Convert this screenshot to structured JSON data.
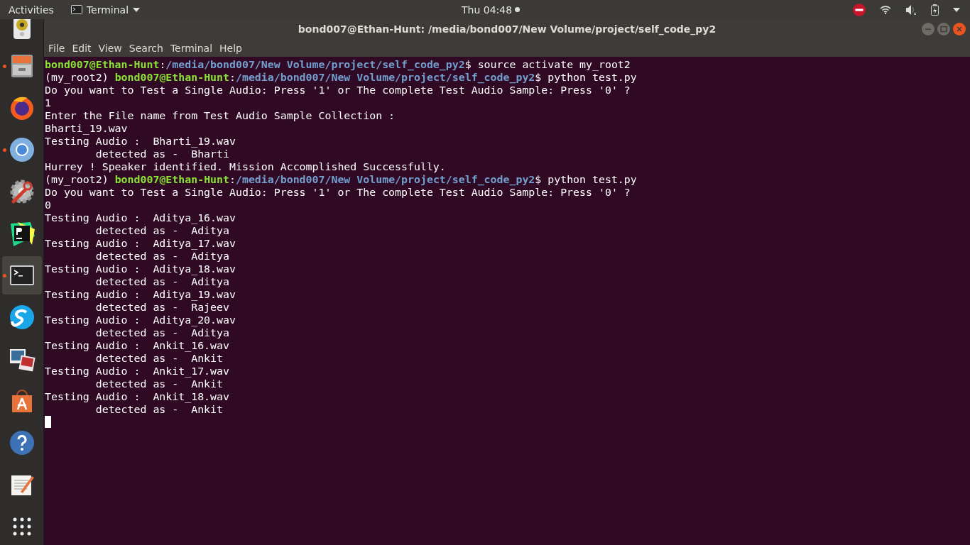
{
  "top_bar": {
    "activities": "Activities",
    "app_menu": "Terminal",
    "clock": "Thu 04:48"
  },
  "dock": [
    {
      "running": false,
      "selected": false
    },
    {
      "running": true,
      "selected": false
    },
    {
      "running": false,
      "selected": false
    },
    {
      "running": true,
      "selected": false
    },
    {
      "running": false,
      "selected": false
    },
    {
      "running": false,
      "selected": false
    },
    {
      "running": true,
      "selected": true
    },
    {
      "running": false,
      "selected": false
    },
    {
      "running": false,
      "selected": false
    },
    {
      "running": false,
      "selected": false
    },
    {
      "running": false,
      "selected": false
    },
    {
      "running": false,
      "selected": false
    },
    {
      "running": false,
      "selected": false
    }
  ],
  "window": {
    "title": "bond007@Ethan-Hunt: /media/bond007/New Volume/project/self_code_py2"
  },
  "menu": [
    "File",
    "Edit",
    "View",
    "Search",
    "Terminal",
    "Help"
  ],
  "terminal": {
    "lines": [
      [
        {
          "kind": "user",
          "text": "bond007@Ethan-Hunt"
        },
        {
          "kind": "plain",
          "text": ":"
        },
        {
          "kind": "path",
          "text": "/media/bond007/New Volume/project/self_code_py2"
        },
        {
          "kind": "plain",
          "text": "$ source activate my_root2"
        }
      ],
      [
        {
          "kind": "plain",
          "text": "(my_root2) "
        },
        {
          "kind": "user",
          "text": "bond007@Ethan-Hunt"
        },
        {
          "kind": "plain",
          "text": ":"
        },
        {
          "kind": "path",
          "text": "/media/bond007/New Volume/project/self_code_py2"
        },
        {
          "kind": "plain",
          "text": "$ python test.py"
        }
      ],
      [
        {
          "kind": "plain",
          "text": "Do you want to Test a Single Audio: Press '1' or The complete Test Audio Sample: Press '0' ?"
        }
      ],
      [
        {
          "kind": "plain",
          "text": "1"
        }
      ],
      [
        {
          "kind": "plain",
          "text": "Enter the File name from Test Audio Sample Collection :"
        }
      ],
      [
        {
          "kind": "plain",
          "text": "Bharti_19.wav"
        }
      ],
      [
        {
          "kind": "plain",
          "text": "Testing Audio :  Bharti_19.wav"
        }
      ],
      [
        {
          "kind": "plain",
          "text": "        detected as -  Bharti"
        }
      ],
      [
        {
          "kind": "plain",
          "text": "Hurrey ! Speaker identified. Mission Accomplished Successfully."
        }
      ],
      [
        {
          "kind": "plain",
          "text": "(my_root2) "
        },
        {
          "kind": "user",
          "text": "bond007@Ethan-Hunt"
        },
        {
          "kind": "plain",
          "text": ":"
        },
        {
          "kind": "path",
          "text": "/media/bond007/New Volume/project/self_code_py2"
        },
        {
          "kind": "plain",
          "text": "$ python test.py"
        }
      ],
      [
        {
          "kind": "plain",
          "text": "Do you want to Test a Single Audio: Press '1' or The complete Test Audio Sample: Press '0' ?"
        }
      ],
      [
        {
          "kind": "plain",
          "text": "0"
        }
      ],
      [
        {
          "kind": "plain",
          "text": "Testing Audio :  Aditya_16.wav"
        }
      ],
      [
        {
          "kind": "plain",
          "text": "        detected as -  Aditya"
        }
      ],
      [
        {
          "kind": "plain",
          "text": "Testing Audio :  Aditya_17.wav"
        }
      ],
      [
        {
          "kind": "plain",
          "text": "        detected as -  Aditya"
        }
      ],
      [
        {
          "kind": "plain",
          "text": "Testing Audio :  Aditya_18.wav"
        }
      ],
      [
        {
          "kind": "plain",
          "text": "        detected as -  Aditya"
        }
      ],
      [
        {
          "kind": "plain",
          "text": "Testing Audio :  Aditya_19.wav"
        }
      ],
      [
        {
          "kind": "plain",
          "text": "        detected as -  Rajeev"
        }
      ],
      [
        {
          "kind": "plain",
          "text": "Testing Audio :  Aditya_20.wav"
        }
      ],
      [
        {
          "kind": "plain",
          "text": "        detected as -  Aditya"
        }
      ],
      [
        {
          "kind": "plain",
          "text": "Testing Audio :  Ankit_16.wav"
        }
      ],
      [
        {
          "kind": "plain",
          "text": "        detected as -  Ankit"
        }
      ],
      [
        {
          "kind": "plain",
          "text": "Testing Audio :  Ankit_17.wav"
        }
      ],
      [
        {
          "kind": "plain",
          "text": "        detected as -  Ankit"
        }
      ],
      [
        {
          "kind": "plain",
          "text": "Testing Audio :  Ankit_18.wav"
        }
      ],
      [
        {
          "kind": "plain",
          "text": "        detected as -  Ankit"
        }
      ]
    ]
  }
}
